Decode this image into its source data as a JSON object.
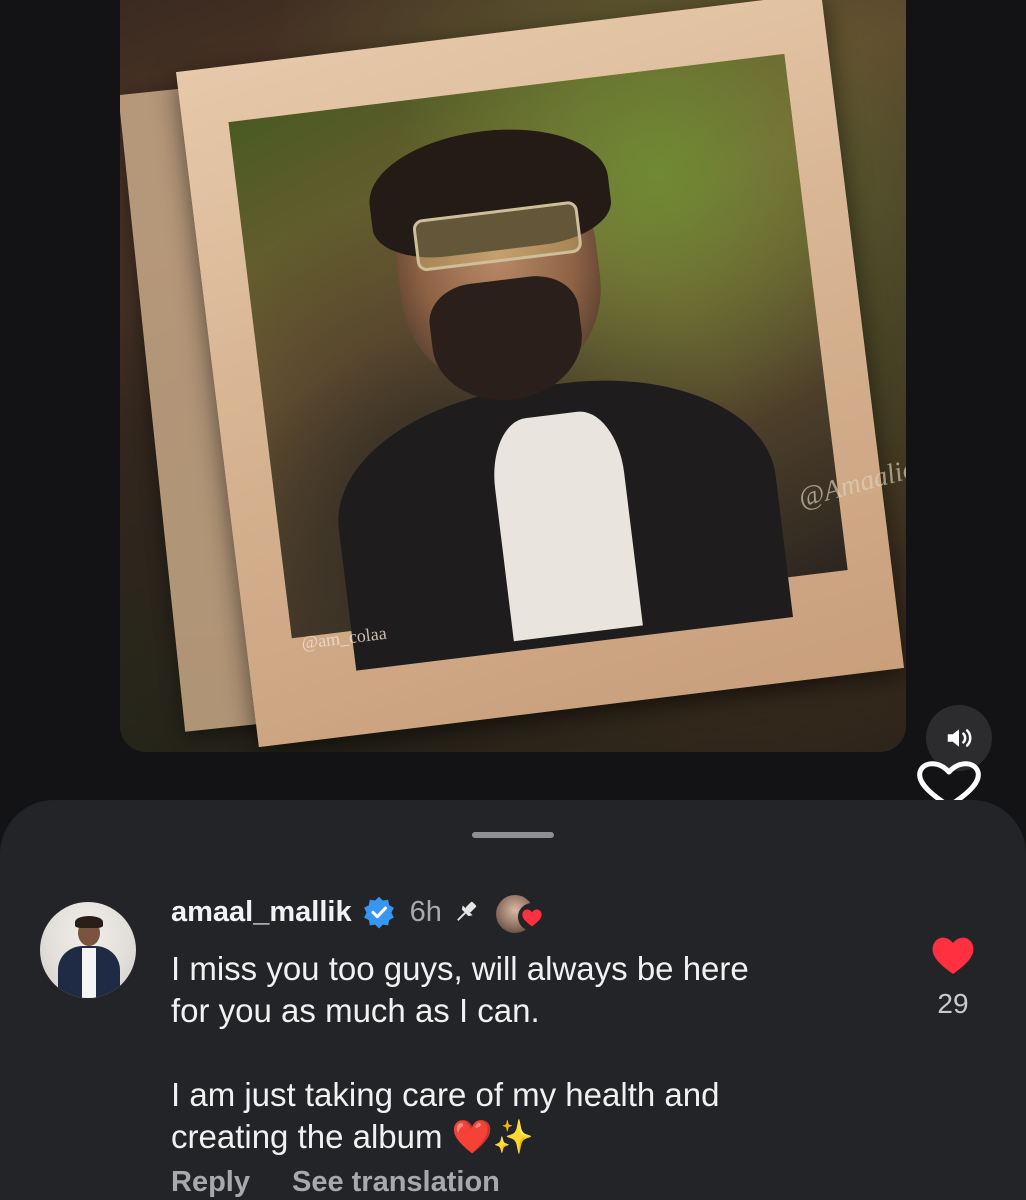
{
  "media": {
    "watermark_left": "@am_colaa",
    "watermark_right": "@Amaalic",
    "sound_icon": "speaker-volume-icon",
    "like_icon": "heart-outline-icon"
  },
  "comment": {
    "username": "amaal_mallik",
    "verified_icon": "verified-badge-icon",
    "timestamp": "6h",
    "pinned_icon": "pin-icon",
    "creator_liked_icon": "creator-heart-icon",
    "text": "I miss you too guys, will always be here\nfor you as much as I can.\n\nI am just taking care of my health and\ncreating the album ❤️✨",
    "like_count": "29",
    "reply_label": "Reply",
    "translation_label": "See translation"
  },
  "colors": {
    "sheet_background": "#232427",
    "accent_verified": "#3797f0",
    "heart_red": "#ff3040",
    "text_primary": "#f1f1f1",
    "text_secondary": "#a8a9ad"
  }
}
